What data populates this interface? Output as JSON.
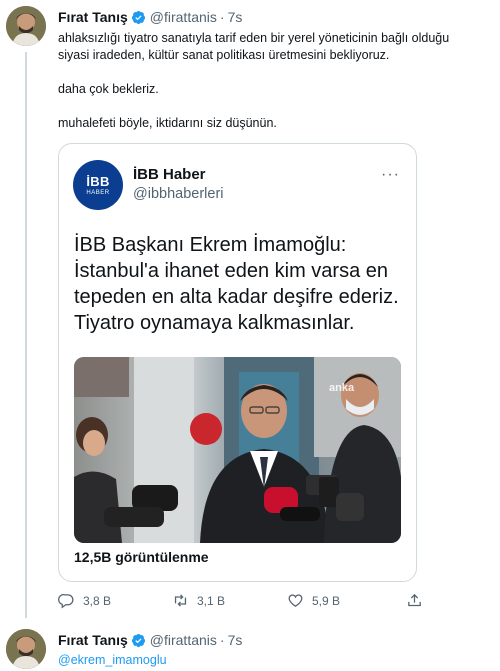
{
  "tweet1": {
    "display_name": "Fırat Tanış",
    "handle": "@firattanis",
    "time": "7s",
    "text_line1": "ahlaksızlığı tiyatro sanatıyla tarif eden bir yerel yöneticinin bağlı olduğu",
    "text_line2": "siyasi iradeden, kültür sanat politikası üretmesini bekliyoruz.",
    "text_line3": "daha çok bekleriz.",
    "text_line4": "muhalefeti böyle, iktidarını siz düşünün."
  },
  "quote": {
    "display_name": "İBB Haber",
    "handle": "@ibbhaberleri",
    "logo_line1": "İBB",
    "logo_line2": "HABER",
    "more": "···",
    "headline_line1": "İBB Başkanı Ekrem İmamoğlu:",
    "headline_line2": "İstanbul'a ihanet eden kim varsa en",
    "headline_line3": "tepeden en alta kadar deşifre ederiz.",
    "headline_line4": "Tiyatro oynamaya kalkmasınlar.",
    "views": "12,5B görüntülenme",
    "photo_watermark": "anka"
  },
  "actions": {
    "reply_count": "3,8 B",
    "retweet_count": "3,1 B",
    "like_count": "5,9 B"
  },
  "tweet2": {
    "display_name": "Fırat Tanış",
    "handle": "@firattanis",
    "time": "7s",
    "mention": "@ekrem_imamoglu"
  },
  "colors": {
    "text": "#0f1419",
    "secondary": "#536471",
    "accent": "#1d9bf0",
    "border": "#cfd9de",
    "ibb_blue": "#0b3d91"
  },
  "icons": [
    "verified-badge-icon",
    "reply-icon",
    "retweet-icon",
    "like-icon",
    "share-icon"
  ],
  "dot_separator": "·"
}
